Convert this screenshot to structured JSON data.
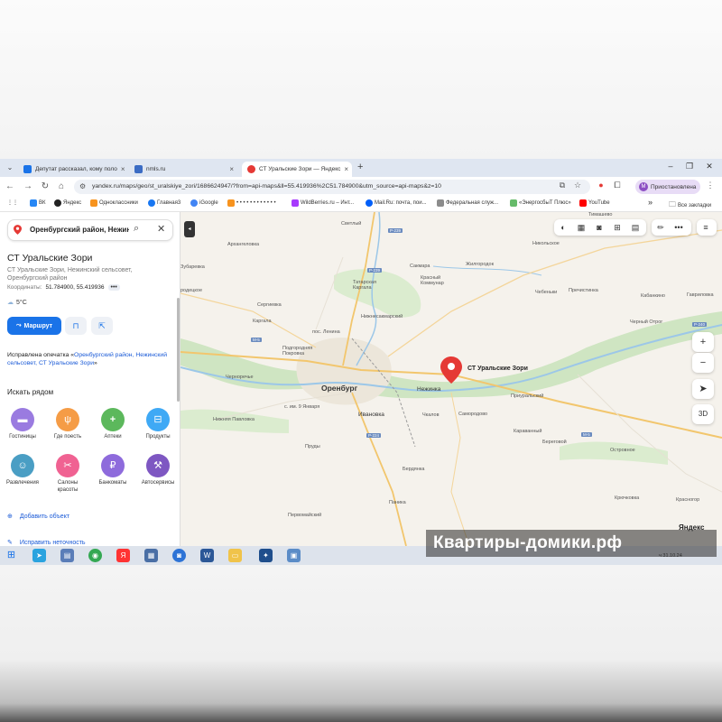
{
  "browser": {
    "tabs": [
      {
        "title": "Депутат рассказал, кому поло",
        "favicon_color": "#1a73e8"
      },
      {
        "title": "nmls.ru",
        "favicon_color": "#3b6cc4"
      },
      {
        "title": "СТ Уральские Зори — Яндекс",
        "favicon_color": "#e53935"
      }
    ],
    "new_tab": "+",
    "url": "yandex.ru/maps/geo/st_uralskiye_zori/1686624947/?from=api-maps&ll=55.419936%2C51.784900&utm_source=api-maps&z=10",
    "profile_initial": "М",
    "profile_label": "Приостановлена"
  },
  "bookmarks": [
    {
      "label": "ВК",
      "color": "#2787f5"
    },
    {
      "label": "Яндекс",
      "color": "#222222"
    },
    {
      "label": "Одноклассники",
      "color": "#f7931e"
    },
    {
      "label": "Главная3",
      "color": "#1877f2"
    },
    {
      "label": "iGoogle",
      "color": "#4285f4"
    },
    {
      "label": "• • • • • • • • • • • •",
      "color": "#f7931e"
    },
    {
      "label": "WildBerries.ru – Инт...",
      "color": "#a73afd"
    },
    {
      "label": "Mail.Ru: почта, пои...",
      "color": "#005ff9"
    },
    {
      "label": "Федеральная служ...",
      "color": "#8c8c8c"
    },
    {
      "label": "«ЭнергосбыТ Плюс»",
      "color": "#66bb6a"
    },
    {
      "label": "YouTube",
      "color": "#ff0000"
    }
  ],
  "bookmarks_more": "»",
  "all_bookmarks": "Все закладки",
  "panel": {
    "search_value": "Оренбургский район, Нежинск",
    "title": "СТ Уральские Зори",
    "address": "СТ Уральские Зори, Нежинский сельсовет, Оренбургский район",
    "coords_label": "Координаты:",
    "coords_value": "51.784900, 55.419936",
    "coords_more": "•••",
    "weather": "5°C",
    "route_button": "Маршрут",
    "typo_prefix": "Исправлена опечатка «",
    "typo_link": "Оренбургский район, Нежинский сельсовет, СТ Уральские Зори",
    "typo_suffix": "»",
    "nearby_title": "Искать рядом",
    "categories": [
      {
        "label": "Гостиницы",
        "color": "#9a7be0",
        "icon": "bed-icon"
      },
      {
        "label": "Где поесть",
        "color": "#f59c46",
        "icon": "fork-knife-icon"
      },
      {
        "label": "Аптеки",
        "color": "#5cb85c",
        "icon": "pharmacy-cross-icon"
      },
      {
        "label": "Продукты",
        "color": "#3fa9f5",
        "icon": "basket-icon"
      },
      {
        "label": "Развлечения",
        "color": "#4a9ec4",
        "icon": "drama-icon"
      },
      {
        "label": "Салоны красоты",
        "color": "#f06292",
        "icon": "scissors-icon"
      },
      {
        "label": "Банкоматы",
        "color": "#8e6bdc",
        "icon": "ruble-icon"
      },
      {
        "label": "Автосервисы",
        "color": "#7e57c2",
        "icon": "car-service-icon"
      }
    ],
    "add_object": "Добавить объект",
    "report_error": "Исправить неточность"
  },
  "map": {
    "marker_label": "СТ Уральские Зори",
    "logo": "Яндекс",
    "zoom_in": "+",
    "zoom_out": "−",
    "view_3d": "3D",
    "places": {
      "orenburg": "Оренбург",
      "nezhinka": "Нежинка",
      "ivanovka": "Ивановка",
      "arkhangelovka": "Архангеловка",
      "tyulgan": "Светлый",
      "zubarevka": "Зубаревка",
      "podgorodnyaya": "Подгородняя Покровка",
      "samorodovo": "Самородово",
      "priuralsky": "Приуральский",
      "chkalov": "Чкалов",
      "beregovoy": "Береговой",
      "karavanny": "Караванный",
      "ostrovnoe": "Островное",
      "berdyanka": "Бердянка",
      "pruды": "Пруды",
      "panika": "Паника",
      "pervomaysky": "Первомайский",
      "kryuchkovka": "Крючковка",
      "krasnogor": "Красногор",
      "nikolskoe": "Никольское",
      "tatarskaya_kargala": "Татарская Каргала",
      "kargala": "Каргала",
      "sergievka": "Сергиевка",
      "nizhnesakmarsky": "Нижнесакмарский",
      "krasny_kommunar": "Красный Коммунар",
      "sakmara": "Сакмара",
      "zhilgorodok": "Жилгородок",
      "chebenki": "Чебеньки",
      "prechistinka": "Пречистинка",
      "kabankino": "Кабанкино",
      "gavrilovka": "Гавриловка",
      "cherny_otrog": "Черный Отрог",
      "timashevo": "Тимашево",
      "chernorechye": "Черноречье",
      "nizhnyaya_pavlovka": "Нижняя Павловка",
      "pos_lenina": "пос. Ленина",
      "gorodok": "родецкое",
      "im9jan": "с. им. 9 Января",
      "pechiy": "Печный"
    },
    "roads": [
      "Р-239",
      "Р-239",
      "М-5",
      "М-5",
      "Р-224",
      "Р-240"
    ]
  },
  "watermark": "Квартиры-домики.рф",
  "tray_date": "ч 31.10.24"
}
